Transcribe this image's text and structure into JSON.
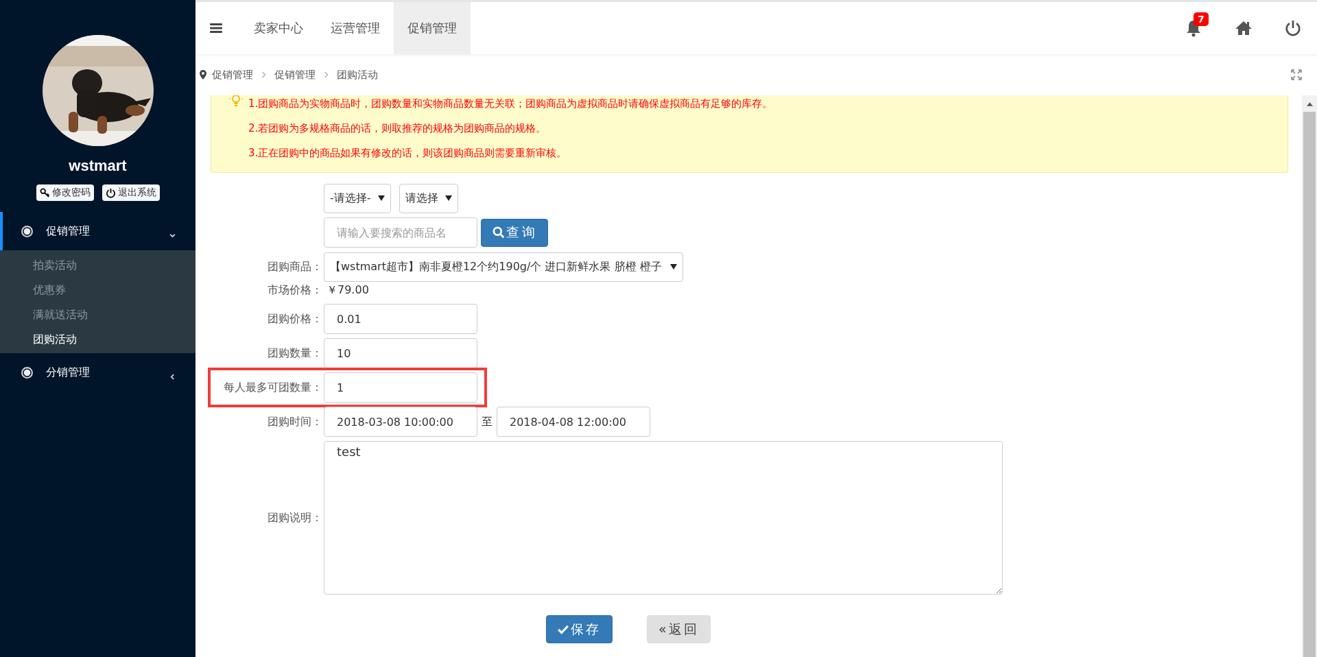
{
  "sidebar": {
    "user_name": "wstmart",
    "account_buttons": [
      {
        "label": "修改密码",
        "kind": "key"
      },
      {
        "label": "退出系统",
        "kind": "power"
      }
    ],
    "menu": [
      {
        "label": "促销管理",
        "selected": true,
        "expanded": true,
        "children": [
          {
            "label": "拍卖活动",
            "selected": false
          },
          {
            "label": "优惠券",
            "selected": false
          },
          {
            "label": "满就送活动",
            "selected": false
          },
          {
            "label": "团购活动",
            "selected": true
          }
        ]
      },
      {
        "label": "分销管理",
        "selected": false,
        "expanded": false
      }
    ]
  },
  "topbar": {
    "tabs": [
      {
        "label": "卖家中心",
        "selected": false
      },
      {
        "label": "运营管理",
        "selected": false
      },
      {
        "label": "促销管理",
        "selected": true
      }
    ],
    "notification_count": "7"
  },
  "breadcrumb": [
    "促销管理",
    "促销管理",
    "团购活动"
  ],
  "notice": [
    "1.团购商品为实物商品时，团购数量和实物商品数量无关联；团购商品为虚拟商品时请确保虚拟商品有足够的库存。",
    "2.若团购为多规格商品的话，则取推荐的规格为团购商品的规格。",
    "3.正在团购中的商品如果有修改的话，则该团购商品则需要重新审核。"
  ],
  "form": {
    "category_selects": [
      "-请选择-",
      "请选择"
    ],
    "search": {
      "placeholder": "请输入要搜索的商品名",
      "button": "查询"
    },
    "product": {
      "label": "团购商品：",
      "value": "【wstmart超市】南非夏橙12个约190g/个 进口新鲜水果 脐橙 橙子"
    },
    "market_price": {
      "label": "市场价格：",
      "value": "￥79.00"
    },
    "inputs": [
      {
        "label": "团购价格：",
        "value": "0.01",
        "highlighted": false
      },
      {
        "label": "团购数量：",
        "value": "10",
        "highlighted": false
      },
      {
        "label": "每人最多可团数量：",
        "value": "1",
        "highlighted": true
      }
    ],
    "time": {
      "label": "团购时间：",
      "start": "2018-03-08 10:00:00",
      "separator": "至",
      "end": "2018-04-08 12:00:00"
    },
    "description": {
      "label": "团购说明：",
      "value": "test"
    }
  },
  "buttons": [
    {
      "label": "保存",
      "kind": "primary"
    },
    {
      "label": "«返回",
      "kind": "secondary"
    }
  ]
}
